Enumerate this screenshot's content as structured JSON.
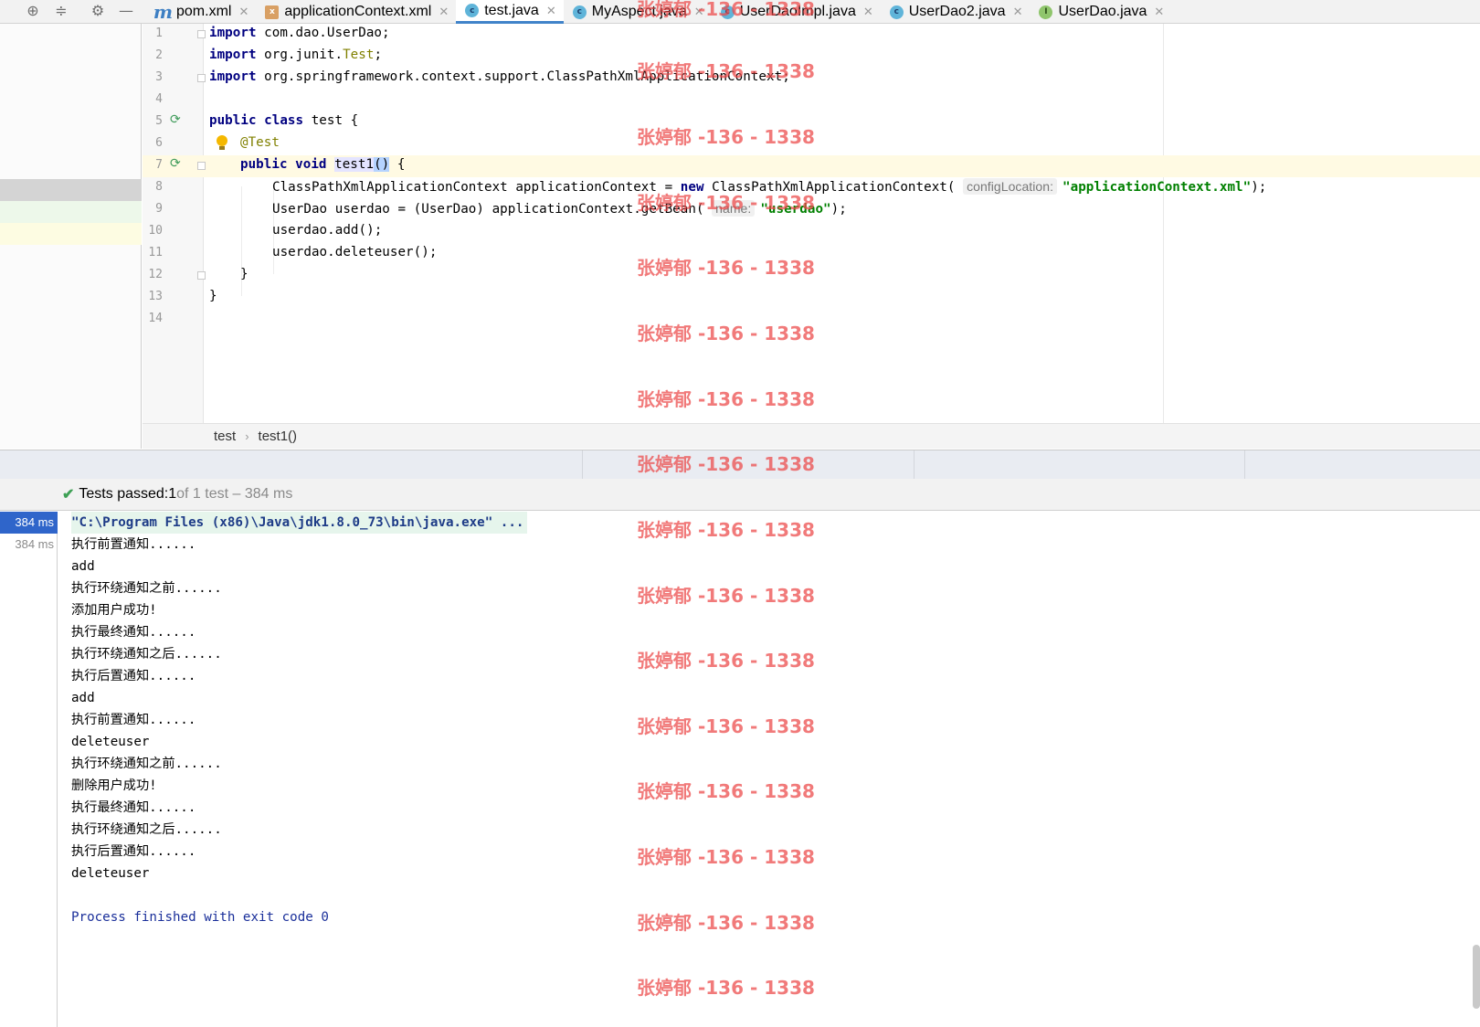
{
  "editor_tabs": [
    {
      "label": "pom.xml",
      "icon": "maven-icon",
      "active": false
    },
    {
      "label": "applicationContext.xml",
      "icon": "xml-file-icon",
      "active": false
    },
    {
      "label": "test.java",
      "icon": "java-class-icon",
      "active": true
    },
    {
      "label": "MyAspect.java",
      "icon": "java-class-icon",
      "active": false
    },
    {
      "label": "UserDaoImpl.java",
      "icon": "java-class-icon",
      "active": false
    },
    {
      "label": "UserDao2.java",
      "icon": "java-class-icon",
      "active": false
    },
    {
      "label": "UserDao.java",
      "icon": "java-interface-icon",
      "active": false
    }
  ],
  "code": {
    "line_numbers": [
      "1",
      "2",
      "3",
      "4",
      "5",
      "6",
      "7",
      "8",
      "9",
      "10",
      "11",
      "12",
      "13",
      "14"
    ],
    "l1_kw": "import",
    "l1_rest": " com.dao.UserDao;",
    "l2_kw": "import",
    "l2_a": " org.junit.",
    "l2_cls": "Test",
    "l2_b": ";",
    "l3_kw": "import",
    "l3_rest": " org.springframework.context.support.ClassPathXmlApplicationContext;",
    "l5_kw": "public class",
    "l5_rest": " test {",
    "l6_ann": "@Test",
    "l7_kw": "public void",
    "l7_sp": " ",
    "l7_method": "test1",
    "l7_paren": "()",
    "l7_rest": " {",
    "l8_a": "ClassPathXmlApplicationContext applicationContext = ",
    "l8_new": "new",
    "l8_b": " ClassPathXmlApplicationContext( ",
    "l8_hint": "configLocation:",
    "l8_str": "\"applicationContext.xml\"",
    "l8_c": ");",
    "l9_a": "UserDao userdao = (UserDao) applicationContext.getBean( ",
    "l9_hint": "name:",
    "l9_str": "\"userdao\"",
    "l9_c": ");",
    "l10": "userdao.add();",
    "l11": "userdao.deleteuser();",
    "l12": "}",
    "l13": "}"
  },
  "breadcrumb": {
    "class": "test",
    "method": "test1()"
  },
  "test_status": {
    "prefix": "Tests passed: ",
    "passed": "1",
    "suffix": " of 1 test – 384 ms"
  },
  "timings": [
    "384 ms",
    "384 ms"
  ],
  "console_lines": [
    "\"C:\\Program Files (x86)\\Java\\jdk1.8.0_73\\bin\\java.exe\" ...",
    "执行前置通知......",
    "add",
    "执行环绕通知之前......",
    "添加用户成功!",
    "执行最终通知......",
    "执行环绕通知之后......",
    "执行后置通知......",
    "add",
    "执行前置通知......",
    "deleteuser",
    "执行环绕通知之前......",
    "删除用户成功!",
    "执行最终通知......",
    "执行环绕通知之后......",
    "执行后置通知......",
    "deleteuser",
    "",
    "Process finished with exit code 0"
  ],
  "watermark": "张婷郁 -136 - 1338",
  "colors": {
    "accent": "#4083c9",
    "keyword": "#000080",
    "string": "#008000",
    "annotation": "#808000",
    "pass": "#3ea055",
    "watermark": "#eb4646"
  }
}
